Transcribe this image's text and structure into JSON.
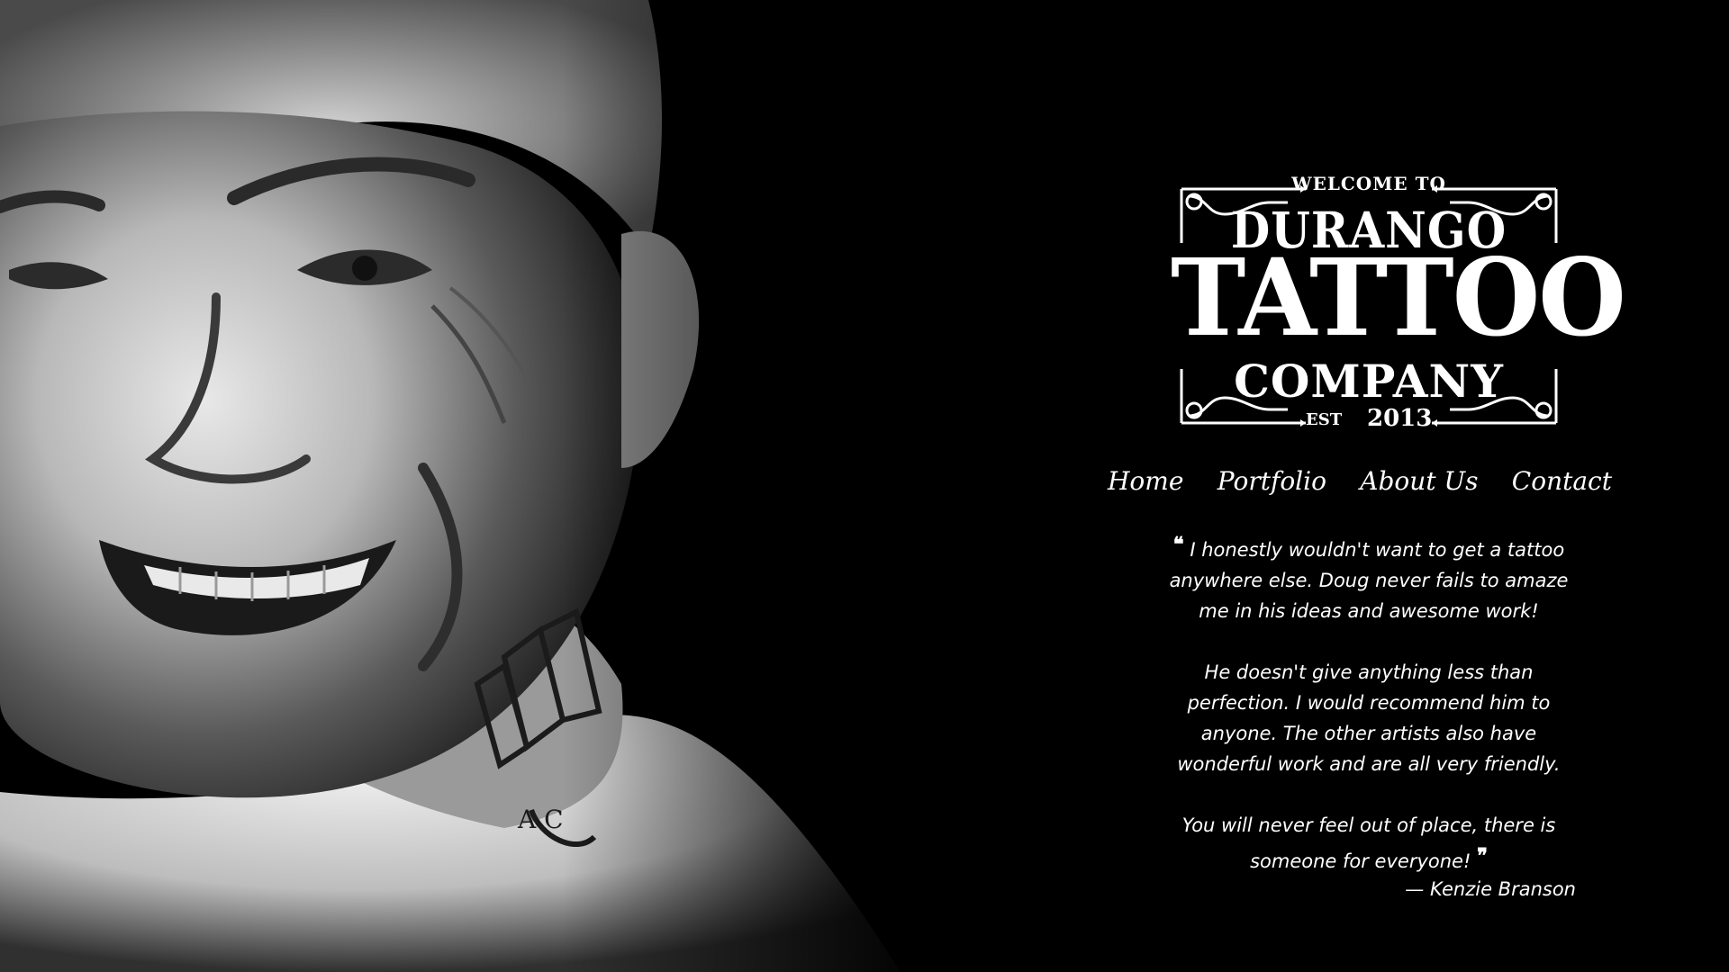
{
  "logo": {
    "welcome": "WELCOME TO",
    "line1": "DURANGO",
    "line2": "TATTOO",
    "line3": "COMPANY",
    "est": "EST",
    "year": "2013"
  },
  "nav": {
    "items": [
      "Home",
      "Portfolio",
      "About Us",
      "Contact"
    ]
  },
  "testimonial": {
    "open_quote": "❝",
    "close_quote": "❞",
    "paragraphs": [
      "I honestly wouldn't want to get a tattoo anywhere else. Doug never fails to amaze me in his ideas and awesome work!",
      "He doesn't give anything less than perfection. I would recommend him to anyone. The other artists also have wonderful work and are all very friendly.",
      "You will never feel out of place, there is someone for everyone!"
    ],
    "author": "— Kenzie Branson"
  },
  "colors": {
    "background": "#000000",
    "text": "#ffffff"
  }
}
